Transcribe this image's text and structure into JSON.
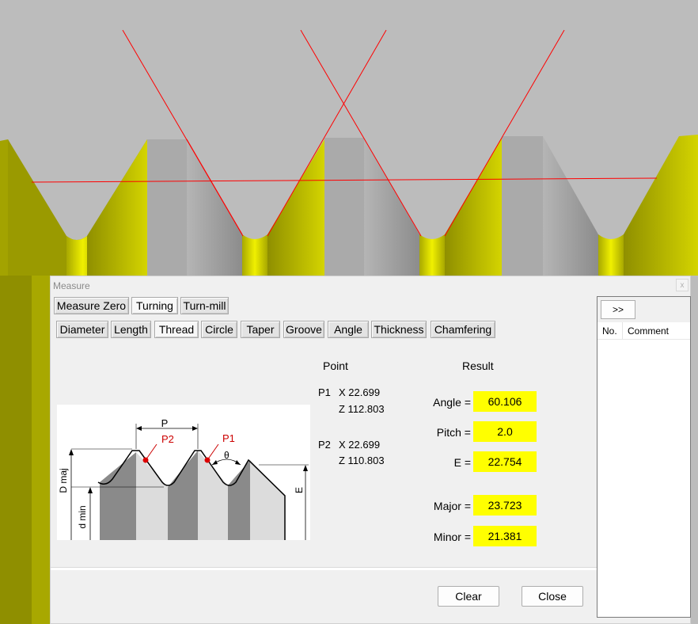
{
  "dialog": {
    "title": "Measure",
    "close_label": "x"
  },
  "modes": [
    {
      "label": "Measure Zero"
    },
    {
      "label": "Turning"
    },
    {
      "label": "Turn-mill"
    }
  ],
  "tools": [
    {
      "label": "Diameter"
    },
    {
      "label": "Length"
    },
    {
      "label": "Thread"
    },
    {
      "label": "Circle"
    },
    {
      "label": "Taper"
    },
    {
      "label": "Groove"
    },
    {
      "label": "Angle"
    },
    {
      "label": "Thickness"
    },
    {
      "label": "Chamfering"
    }
  ],
  "diagram": {
    "label_p": "P",
    "label_p1": "P1",
    "label_p2": "P2",
    "label_theta": "θ",
    "label_dmaj": "D maj",
    "label_dmin": "d min",
    "label_e": "E"
  },
  "point": {
    "header": "Point",
    "p1_label": "P1",
    "p1_x": "X 22.699",
    "p1_z": "Z 112.803",
    "p2_label": "P2",
    "p2_x": "X 22.699",
    "p2_z": "Z 110.803"
  },
  "result": {
    "header": "Result",
    "angle_label": "Angle =",
    "angle_value": "60.106",
    "pitch_label": "Pitch =",
    "pitch_value": "2.0",
    "e_label": "E =",
    "e_value": "22.754",
    "major_label": "Major =",
    "major_value": "23.723",
    "minor_label": "Minor =",
    "minor_value": "21.381"
  },
  "actions": {
    "clear_label": "Clear",
    "close_label": "Close"
  },
  "side_panel": {
    "expand_label": ">>",
    "col_no": "No.",
    "col_comment": "Comment"
  },
  "colors": {
    "highlight": "#ffff00",
    "thread_yellow": "#c8c800",
    "measure_line": "#ff0000"
  }
}
